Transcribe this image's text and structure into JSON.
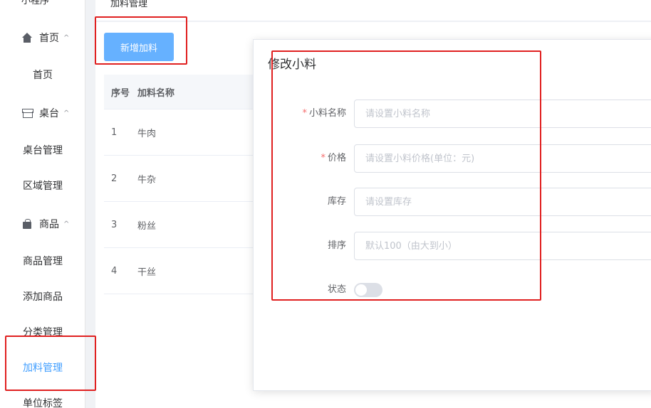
{
  "sidebar": {
    "cut_label": "小程序",
    "groups": [
      {
        "label": "首页",
        "chevron": "^"
      },
      {
        "label": "桌台",
        "chevron": "^"
      },
      {
        "label": "商品",
        "chevron": "^"
      }
    ],
    "items": [
      "首页",
      "桌台管理",
      "区域管理",
      "商品管理",
      "添加商品",
      "分类管理",
      "加料管理",
      "单位标签"
    ]
  },
  "breadcrumb": "加料管理",
  "toolbar": {
    "add_label": "新增加料"
  },
  "table": {
    "headers": [
      "序号",
      "加料名称"
    ],
    "rows": [
      [
        "1",
        "牛肉"
      ],
      [
        "2",
        "牛杂"
      ],
      [
        "3",
        "粉丝"
      ],
      [
        "4",
        "干丝"
      ]
    ]
  },
  "dialog": {
    "title": "修改小料",
    "fields": {
      "name": {
        "label": "小料名称",
        "placeholder": "请设置小料名称",
        "required": true
      },
      "price": {
        "label": "价格",
        "placeholder": "请设置小料价格(单位：元)",
        "required": true
      },
      "stock": {
        "label": "库存",
        "placeholder": "请设置库存"
      },
      "sort": {
        "label": "排序",
        "placeholder": "默认100（由大到小）"
      },
      "status": {
        "label": "状态",
        "enabled": false
      }
    },
    "required_mark": "*"
  },
  "colors": {
    "accent": "#409eff",
    "button": "#66b1ff",
    "highlight": "#e02020",
    "required": "#f56c6c"
  },
  "icons": {
    "home": "home-icon",
    "table": "box-icon",
    "goods": "bag-icon"
  }
}
